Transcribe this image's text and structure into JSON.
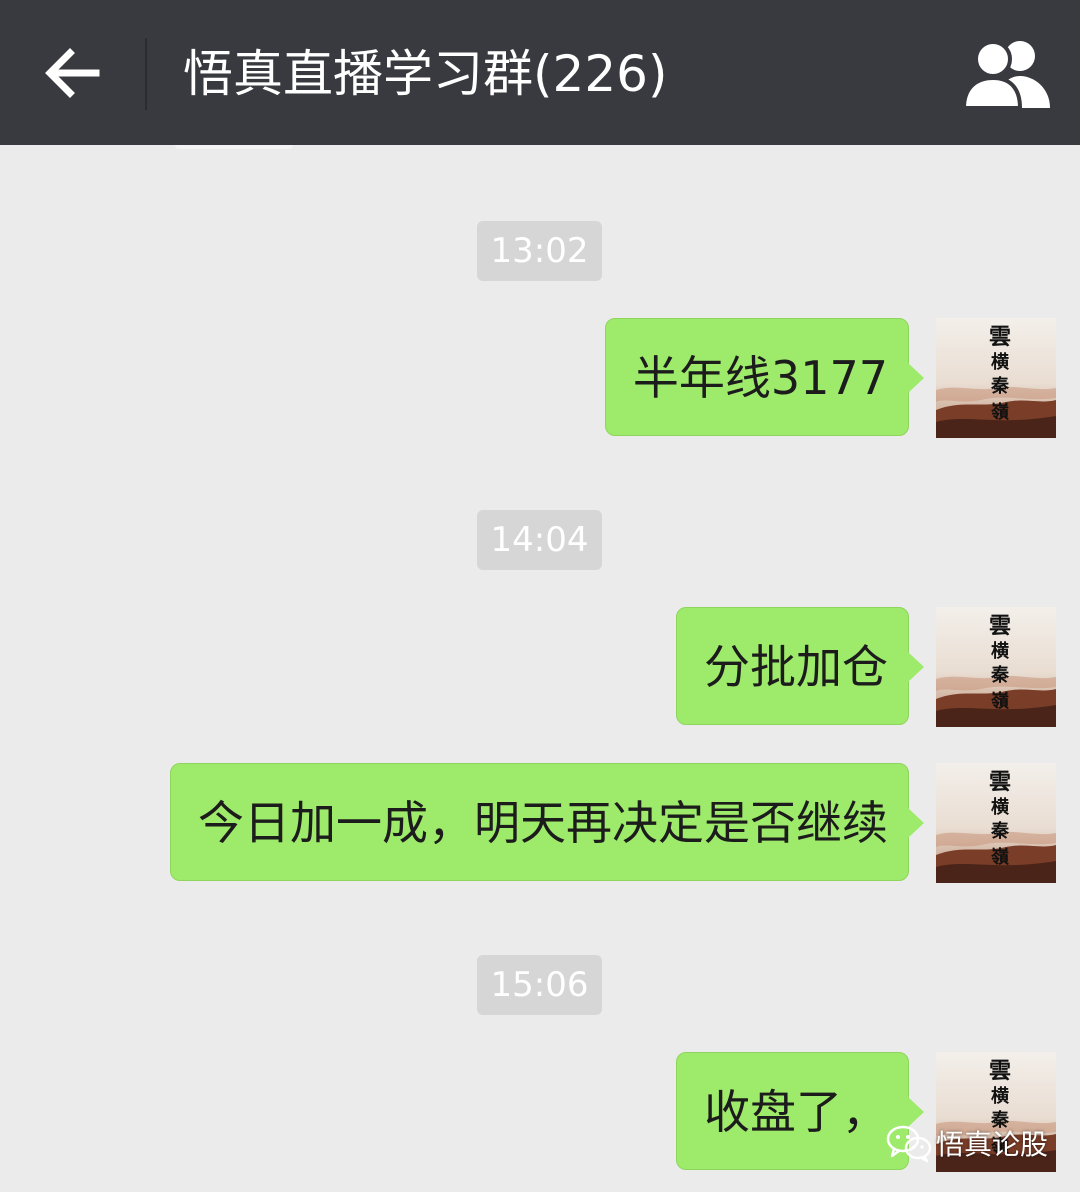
{
  "header": {
    "title": "悟真直播学习群(226)",
    "back_icon": "arrow-left-icon",
    "members_icon": "group-members-icon",
    "background_color": "#393a3f"
  },
  "chat": {
    "background_color": "#ebebeb",
    "bubble_color": "#9eea6a",
    "messages": [
      {
        "timestamp": "13:02",
        "text": "半年线3177"
      },
      {
        "timestamp": "14:04",
        "text": "分批加仓"
      },
      {
        "text": "今日加一成，明天再决定是否继续"
      },
      {
        "timestamp": "15:06",
        "text": "收盘了，"
      }
    ],
    "avatar": {
      "icon": "calligraphy-avatar-icon",
      "calligraphy_text": "雲横秦嶺"
    }
  },
  "watermark": {
    "icon": "wechat-icon",
    "text": "悟真论股"
  }
}
